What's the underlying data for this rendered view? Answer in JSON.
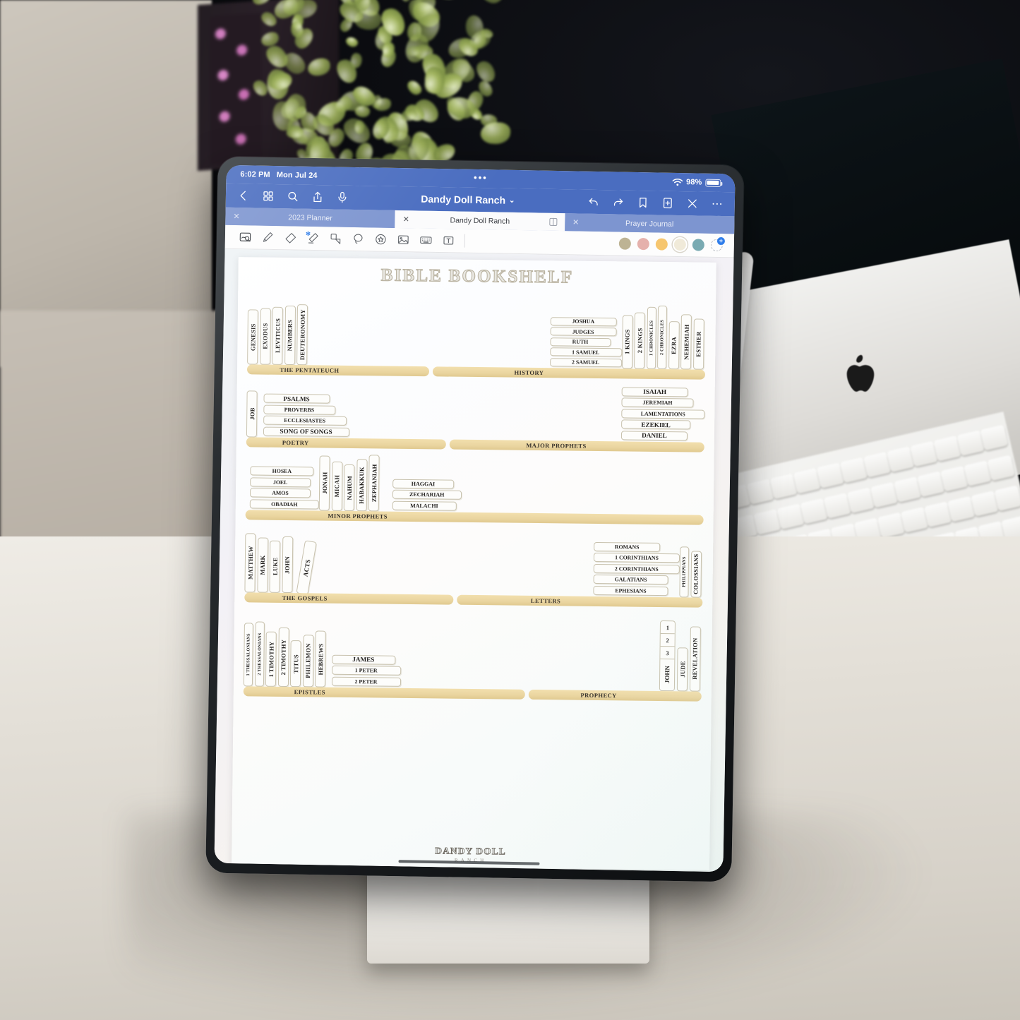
{
  "status_bar": {
    "time": "6:02 PM",
    "date": "Mon Jul 24",
    "battery_percent": "98%",
    "wifi_icon": "wifi-icon",
    "battery_icon": "battery-icon",
    "handle_dots": "•••"
  },
  "title_bar": {
    "document_title": "Dandy Doll Ranch",
    "chevron": "⌄",
    "left_icons": [
      "back-chevron-icon",
      "grid-thumbnails-icon",
      "search-icon",
      "share-icon",
      "microphone-icon"
    ],
    "right_icons": [
      "undo-icon",
      "redo-icon",
      "bookmark-icon",
      "add-page-icon",
      "close-icon",
      "more-icon"
    ]
  },
  "tabs": [
    {
      "label": "2023 Planner",
      "active": false,
      "close": "✕"
    },
    {
      "label": "Dandy Doll Ranch",
      "active": true,
      "close": "✕"
    },
    {
      "label": "Prayer Journal",
      "active": false,
      "close": "✕"
    }
  ],
  "toolbar": {
    "tools": [
      {
        "name": "zoom-reader-tool",
        "selected": true
      },
      {
        "name": "pen-tool",
        "selected": false
      },
      {
        "name": "eraser-tool",
        "selected": false
      },
      {
        "name": "highlighter-tool",
        "selected": false,
        "badge": "✻"
      },
      {
        "name": "shapes-tool",
        "selected": false
      },
      {
        "name": "lasso-tool",
        "selected": false
      },
      {
        "name": "sticker-tool",
        "selected": false
      },
      {
        "name": "image-tool",
        "selected": false
      },
      {
        "name": "keyboard-tool",
        "selected": false
      },
      {
        "name": "text-box-tool",
        "selected": false
      }
    ],
    "swatches": [
      {
        "name": "swatch-khaki",
        "color": "#bdb394",
        "selected": false
      },
      {
        "name": "swatch-pink",
        "color": "#e5b1ac",
        "selected": false
      },
      {
        "name": "swatch-orange",
        "color": "#f6c66f",
        "selected": false
      },
      {
        "name": "swatch-cream",
        "color": "#f0ead9",
        "selected": true
      },
      {
        "name": "swatch-teal",
        "color": "#79aab2",
        "selected": false
      },
      {
        "name": "swatch-add",
        "color": "",
        "selected": false,
        "plus": "+"
      }
    ]
  },
  "worksheet": {
    "title": "BIBLE BOOKSHELF",
    "footer_line1": "DANDY DOLL",
    "footer_line2": "RANCH",
    "shelves": [
      {
        "id": "shelf-1",
        "groups": [
          {
            "label": "THE PENTATEUCH",
            "vertical": [
              "GENESIS",
              "EXODUS",
              "LEVITICUS",
              "NUMBERS",
              "DEUTERONOMY"
            ],
            "stack": [],
            "vertical2": []
          },
          {
            "label": "HISTORY",
            "stack": [
              "JOSHUA",
              "JUDGES",
              "RUTH",
              "1 SAMUEL",
              "2 SAMUEL"
            ],
            "vertical": [],
            "vertical2": [
              "1 KINGS",
              "2 KINGS",
              "1 CHRONICLES",
              "2 CHRONICLES",
              "EZRA",
              "NEHEMIAH",
              "ESTHER"
            ]
          }
        ]
      },
      {
        "id": "shelf-2",
        "groups": [
          {
            "label": "POETRY",
            "vertical": [
              "JOB"
            ],
            "stack": [
              "PSALMS",
              "PROVERBS",
              "ECCLESIASTES",
              "SONG OF SONGS"
            ],
            "vertical2": []
          },
          {
            "label": "MAJOR PROPHETS",
            "vertical": [],
            "stack": [
              "ISAIAH",
              "JEREMIAH",
              "LAMENTATIONS",
              "EZEKIEL",
              "DANIEL"
            ],
            "vertical2": []
          }
        ]
      },
      {
        "id": "shelf-3",
        "groups": [
          {
            "label": "MINOR PROPHETS",
            "vertical": [],
            "stack": [
              "HOSEA",
              "JOEL",
              "AMOS",
              "OBADIAH"
            ],
            "vertical2": [
              "JONAH",
              "MICAH",
              "NAHUM",
              "HABAKKUK",
              "ZEPHANIAH"
            ],
            "stack2": [
              "HAGGAI",
              "ZECHARIAH",
              "MALACHI"
            ]
          }
        ]
      },
      {
        "id": "shelf-4",
        "groups": [
          {
            "label": "THE GOSPELS",
            "vertical": [
              "MATTHEW",
              "MARK",
              "LUKE",
              "JOHN"
            ],
            "tilted": "ACTS",
            "stack": [],
            "vertical2": []
          },
          {
            "label": "LETTERS",
            "vertical": [],
            "stack": [
              "ROMANS",
              "1 CORINTHIANS",
              "2 CORINTHIANS",
              "GALATIANS",
              "EPHESIANS"
            ],
            "vertical2": [
              "PHILIPPIANS",
              "COLOSSIANS"
            ]
          }
        ]
      },
      {
        "id": "shelf-5",
        "groups": [
          {
            "label": "EPISTLES",
            "vertical": [
              "1 THESSALONIANS",
              "2 THESSALONIANS",
              "1 TIMOTHY",
              "2 TIMOTHY",
              "TITUS",
              "PHILEMON",
              "HEBREWS"
            ],
            "stack": [
              "JAMES",
              "1 PETER",
              "2 PETER"
            ],
            "vertical2": []
          },
          {
            "label": "PROPHECY",
            "johns": [
              "1",
              "2",
              "3"
            ],
            "john_label": "JOHN",
            "vertical2": [
              "JUDE",
              "REVELATION"
            ],
            "vertical": [],
            "stack": []
          }
        ]
      }
    ]
  }
}
